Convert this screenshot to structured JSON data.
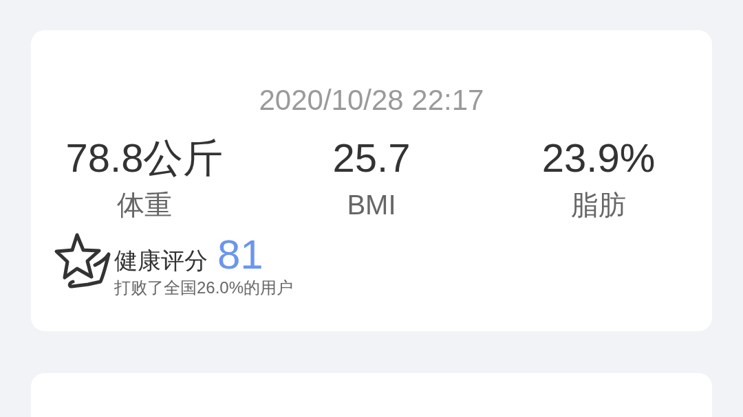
{
  "record": {
    "datetime": "2020/10/28 22:17",
    "metrics": [
      {
        "value": "78.8公斤",
        "label": "体重"
      },
      {
        "value": "25.7",
        "label": "BMI"
      },
      {
        "value": "23.9%",
        "label": "脂肪"
      }
    ],
    "health_score": {
      "label": "健康评分",
      "score": "81",
      "note": "打败了全国26.0%的用户"
    }
  }
}
